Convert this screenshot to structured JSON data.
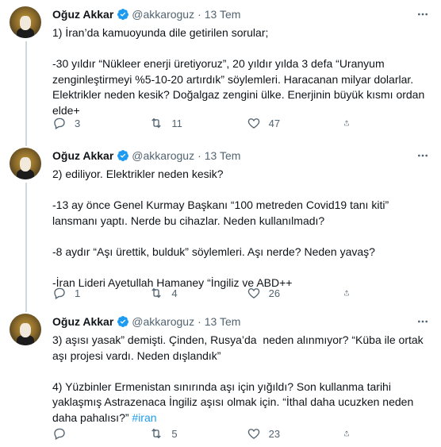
{
  "tweets": [
    {
      "author": {
        "name": "Oğuz Akkar",
        "handle": "@akkaroguz",
        "date": "13 Tem"
      },
      "lines": [
        "1) İran’da kamuoyunda dile getirilen sorular;",
        "",
        "-30 yıldır “Nükleer enerji üretiyoruz”, 20 yıldır yılda 3 defa “Uranyum zenginleştirmeyi %5-10-20 artırdık” söylemleri. Haracanan milyar dolarlar. Elektrikler neden kesik? Doğalgaz zengini ülke. Enerjinin büyük kısmı ordan elde+"
      ],
      "hashtag": "",
      "replies": "3",
      "retweets": "11",
      "likes": "47"
    },
    {
      "author": {
        "name": "Oğuz Akkar",
        "handle": "@akkaroguz",
        "date": "13 Tem"
      },
      "lines": [
        "2) ediliyor. Elektrikler neden kesik?",
        "",
        "-13 ay önce Genel Kurmay Başkanı “100 metreden Covid19 tanı kiti” lansmanı yaptı. Nerde bu cihazlar. Neden kullanılmadı?",
        "",
        "-8 aydır “Aşı ürettik, bulduk” söylemleri. Aşı nerde? Neden yavaş?",
        "",
        "-İran Lideri Ayetullah Hamaney “İngiliz ve ABD++"
      ],
      "hashtag": "",
      "replies": "1",
      "retweets": "4",
      "likes": "26"
    },
    {
      "author": {
        "name": "Oğuz Akkar",
        "handle": "@akkaroguz",
        "date": "13 Tem"
      },
      "lines": [
        "3) aşısı yasak” demişti. Çinden, Rusya’da  neden alınmıyor? “Küba ile ortak aşı projesi vardı. Neden dışlandık”",
        "",
        "4) Yüzbinler Ermenistan sınırında aşı için yığıldı? Son kullanma tarihi yaklaşmış Astrazenaca İngiliz aşısı olmak için. “İthal daha ucuzken neden daha pahalısı?” "
      ],
      "hashtag": "#iran",
      "replies": "",
      "retweets": "5",
      "likes": "23"
    }
  ],
  "colors": {
    "verified": "#1d9bf0",
    "muted": "#536471",
    "text": "#0f1419",
    "thread_line": "#cfd9de",
    "link": "#1d9bf0"
  },
  "icons": {
    "verified": "verified-badge-icon",
    "more": "more-options-icon",
    "reply": "reply-icon",
    "retweet": "retweet-icon",
    "like": "like-heart-icon",
    "share": "share-icon"
  }
}
